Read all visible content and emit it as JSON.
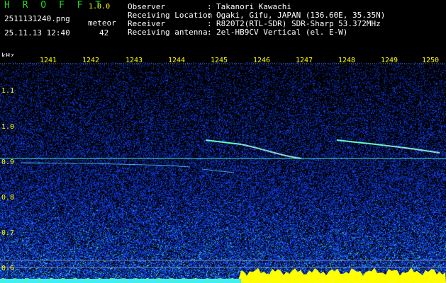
{
  "header": {
    "app_title": "H R O F F T",
    "app_version": "1.0.0",
    "filename": "2511131240.png",
    "timestamp": "25.11.13 12:40",
    "meteor_label": "meteor",
    "meteor_count": "42",
    "info": [
      {
        "label": "Observer",
        "value": "Takanori Kawachi"
      },
      {
        "label": "Receiving Location",
        "value": "Ogaki, Gifu, JAPAN (136.60E, 35.35N)"
      },
      {
        "label": "Receiver",
        "value": "R820T2(RTL-SDR) SDR-Sharp 53.372MHz"
      },
      {
        "label": "Receiving antenna",
        "value": "2el-HB9CV Vertical (el. E-W)"
      }
    ],
    "colon": ":"
  },
  "axis": {
    "unit": "kHz",
    "minute_labels": [
      "1241",
      "1242",
      "1243",
      "1244",
      "1245",
      "1246",
      "1247",
      "1248",
      "1249",
      "1250"
    ],
    "khz_labels": [
      "1.1",
      "1.0",
      "0.9",
      "0.8",
      "0.7",
      "0.6"
    ]
  },
  "colors": {
    "background": "#000000",
    "label_yellow": "#ffff00",
    "title_green": "#22dd22",
    "text_white": "#ffffff",
    "noise_blue": "#0a2cb0",
    "signal_cyan": "#40f0f0",
    "signal_magenta": "#ff50ff"
  }
}
